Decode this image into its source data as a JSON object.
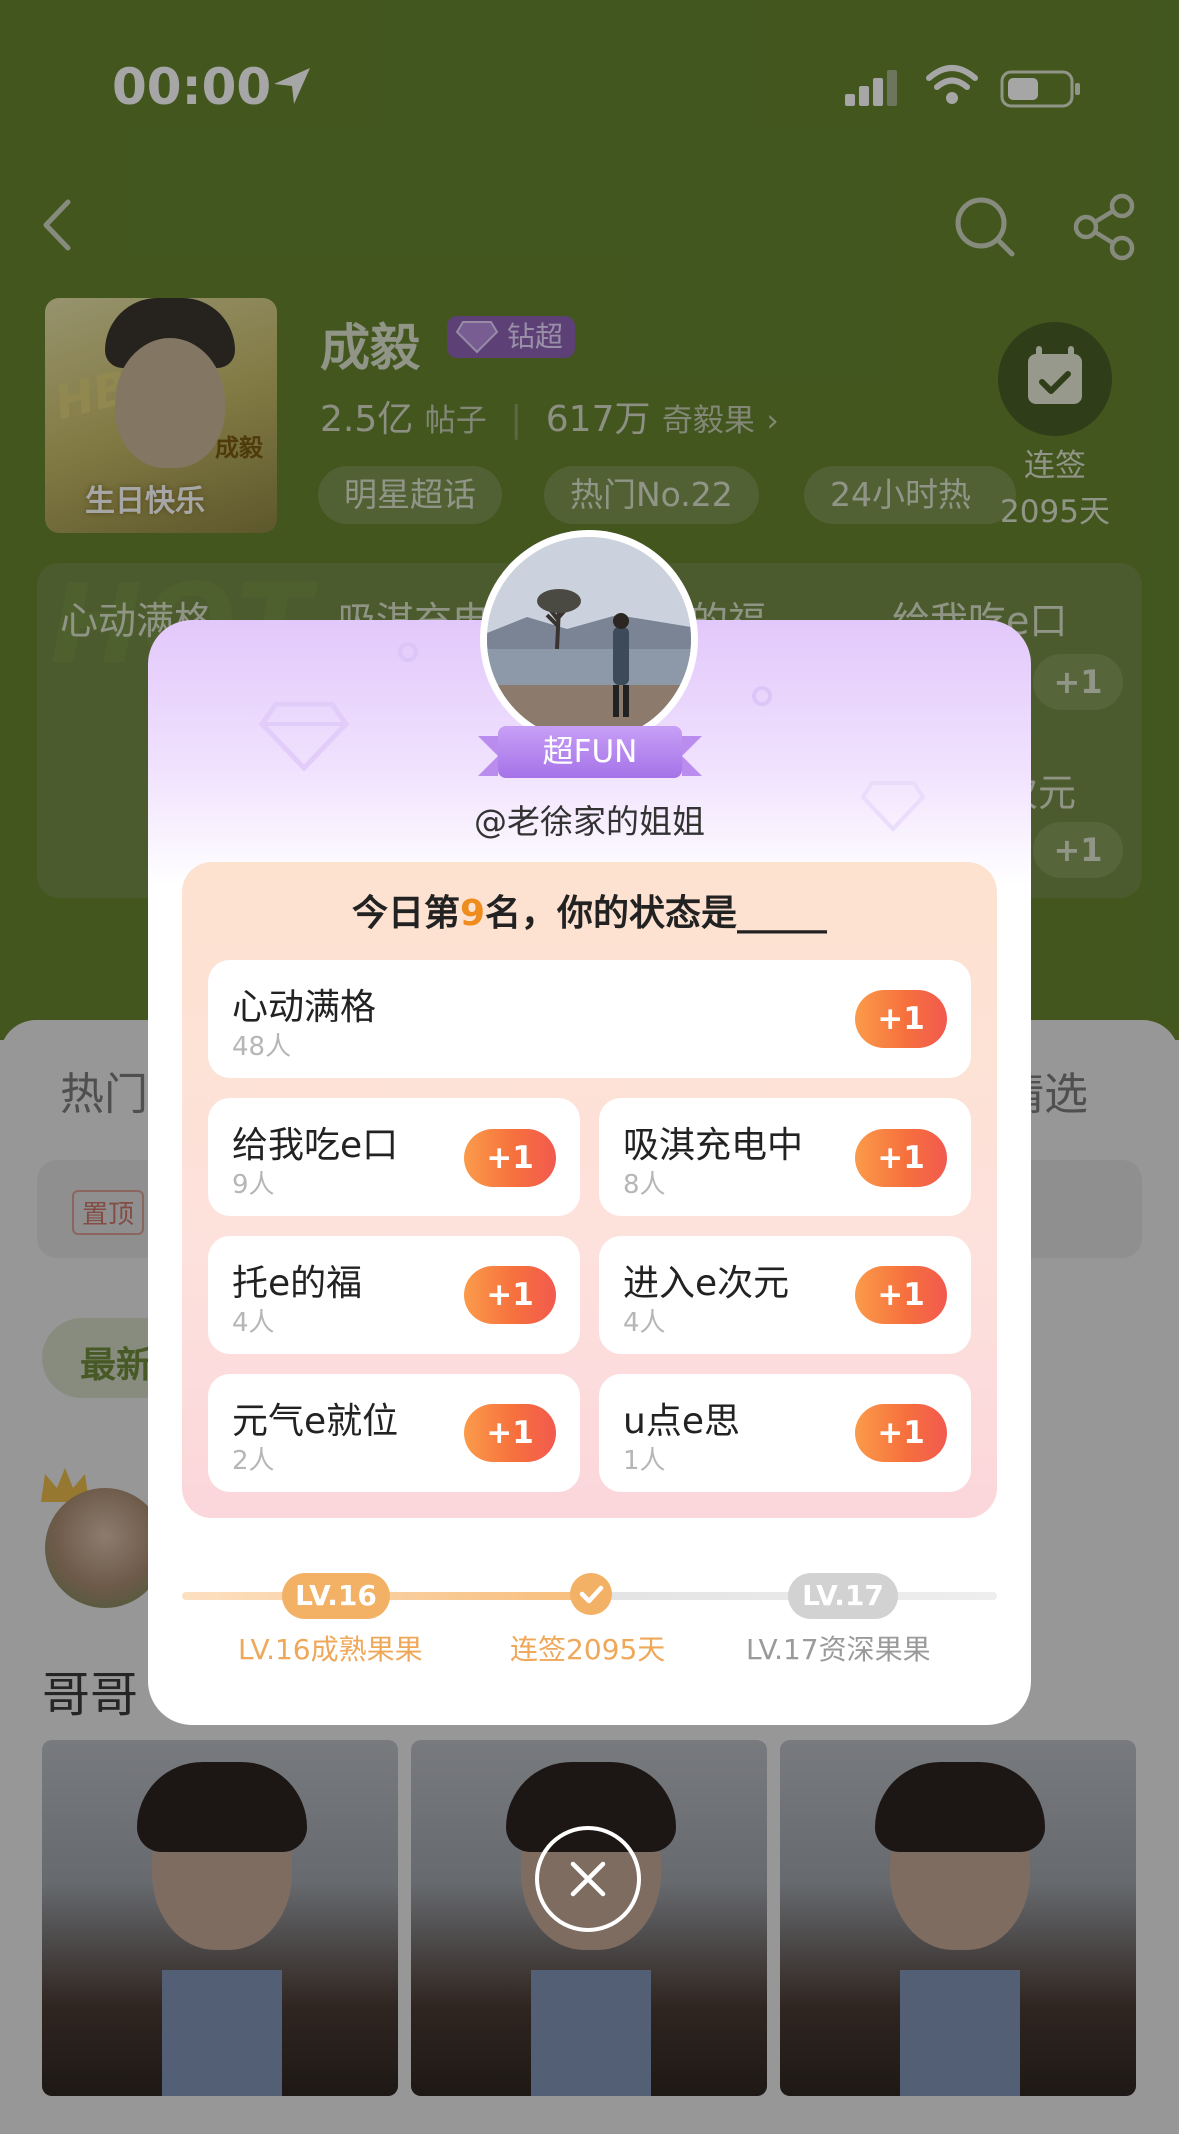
{
  "status_bar": {
    "time": "00:00"
  },
  "topic": {
    "name": "成毅",
    "badge": "钻超",
    "posts_value": "2.5亿",
    "posts_label": "帖子",
    "fans_value": "617万",
    "fans_label": "奇毅果",
    "chips": [
      "明星超话",
      "热门No.22",
      "24小时热"
    ],
    "checkin_label": "连签",
    "checkin_days": "2095天",
    "cover_text": "生日快乐",
    "cover_name": "成毅"
  },
  "background_cards": {
    "items": [
      "心动满格",
      "吸淇充电",
      "的福",
      "给我吃e口",
      "次元"
    ],
    "plus": "+1"
  },
  "lower": {
    "tab_hot": "热门",
    "tab_selected": "精选",
    "pinned_label": "置顶",
    "newest_label": "最新",
    "post_title": "哥哥"
  },
  "popup": {
    "level_tag": "超FUN",
    "username": "@老徐家的姐姐",
    "title_prefix": "今日第",
    "rank": "9",
    "title_suffix": "名，你的状态是_____",
    "options": [
      {
        "name": "心动满格",
        "count": "48人",
        "button": "+1"
      },
      {
        "name": "给我吃e口",
        "count": "9人",
        "button": "+1"
      },
      {
        "name": "吸淇充电中",
        "count": "8人",
        "button": "+1"
      },
      {
        "name": "托e的福",
        "count": "4人",
        "button": "+1"
      },
      {
        "name": "进入e次元",
        "count": "4人",
        "button": "+1"
      },
      {
        "name": "元气e就位",
        "count": "2人",
        "button": "+1"
      },
      {
        "name": "u点e思",
        "count": "1人",
        "button": "+1"
      }
    ],
    "level_current": "LV.16",
    "level_next": "LV.17",
    "level_current_caption": "LV.16成熟果果",
    "checkin_caption": "连签2095天",
    "level_next_caption": "LV.17资深果果",
    "progress_fraction": 0.5
  },
  "colors": {
    "header_green": "#66842f",
    "popup_purple": "#a573e8",
    "plus_orange": "#f6703d",
    "level_orange": "#f3b166",
    "rank_orange": "#ee8c1d"
  }
}
